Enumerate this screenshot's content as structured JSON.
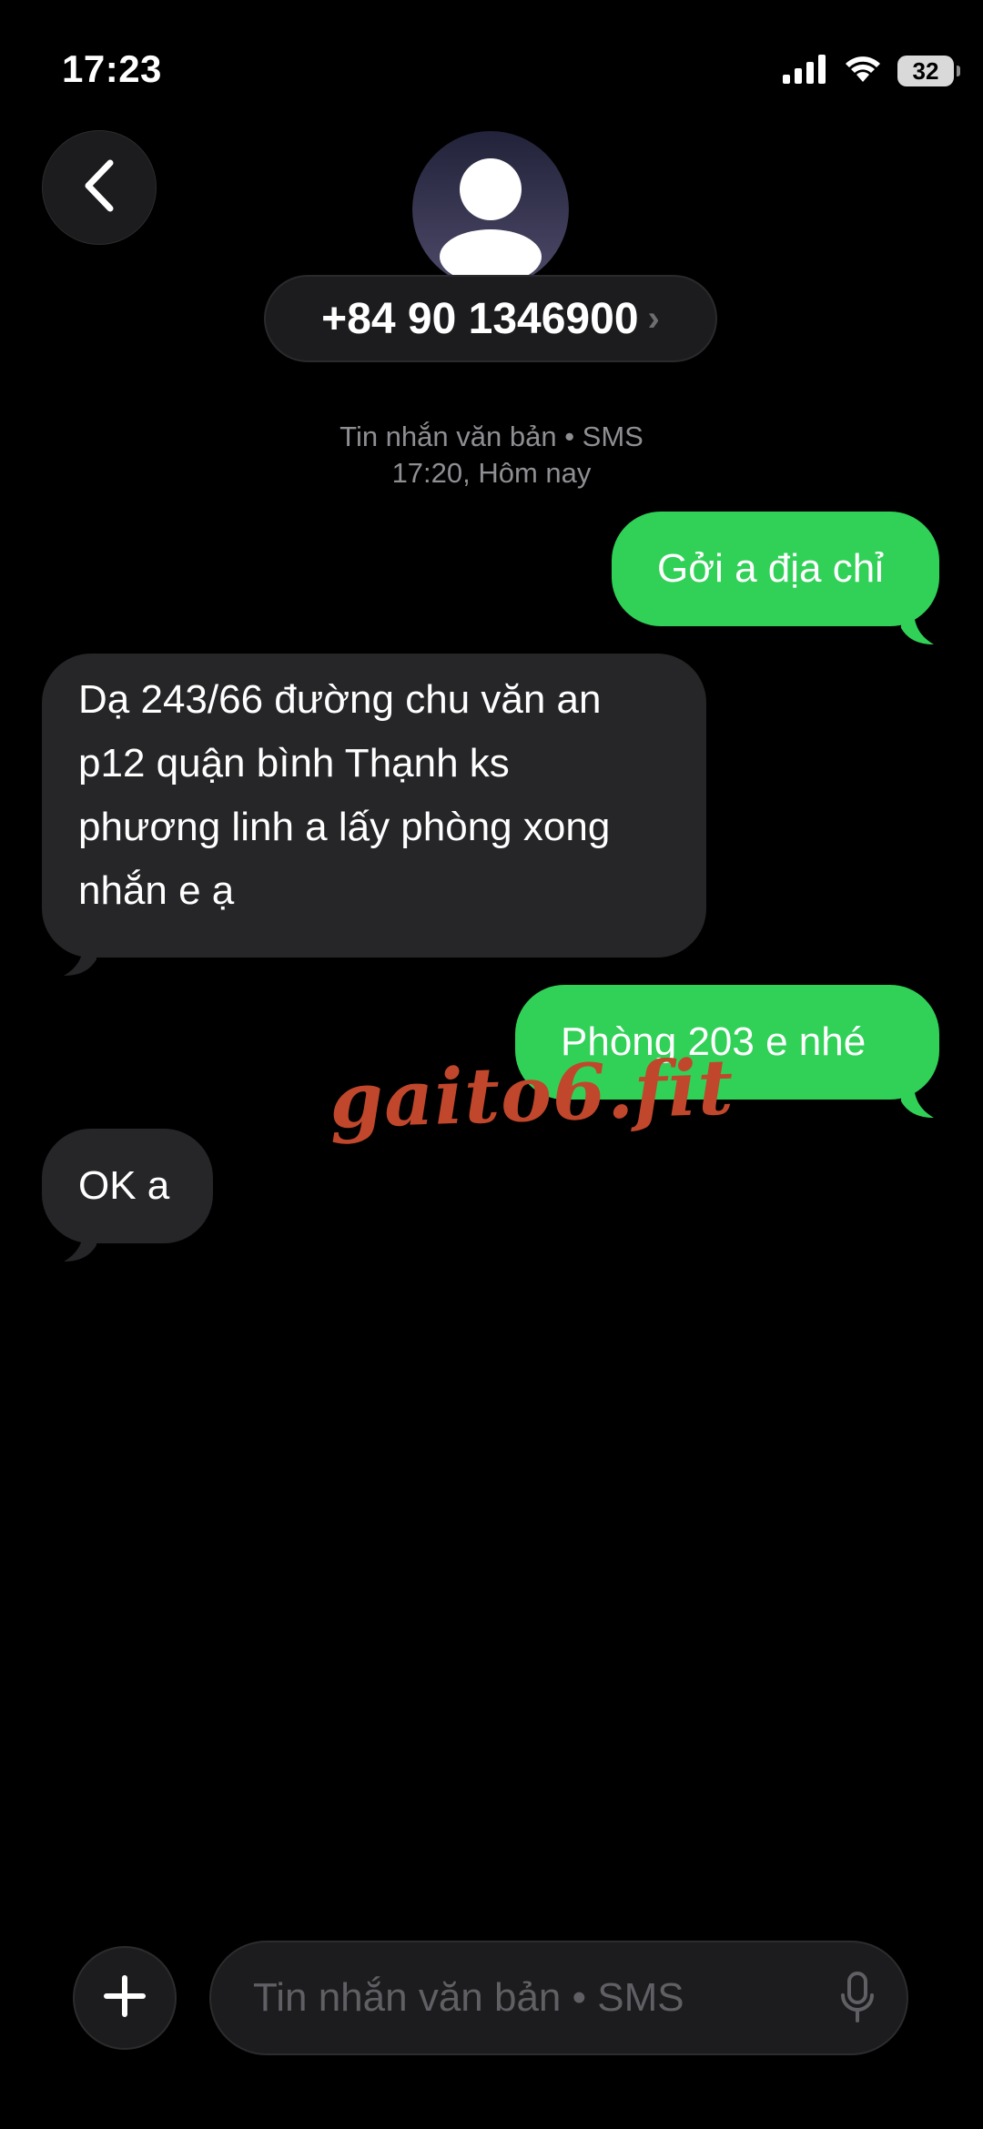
{
  "status_bar": {
    "time": "17:23",
    "battery": "32"
  },
  "header": {
    "contact_number": "+84 90 1346900",
    "chevron": "›",
    "back_icon": "chevron-left-icon",
    "avatar_icon": "person-silhouette-icon"
  },
  "conversation": {
    "channel_label": "Tin nhắn văn bản • SMS",
    "timestamp": "17:20, Hôm nay",
    "messages": [
      {
        "direction": "outgoing",
        "text": "Gởi a địa chỉ"
      },
      {
        "direction": "incoming",
        "lines": [
          "Dạ 243/66 đường chu văn an",
          "p12 quận bình Thạnh ks",
          "phương linh a lấy phòng xong",
          "nhắn e ạ"
        ]
      },
      {
        "direction": "outgoing",
        "text": "Phòng 203 e nhé"
      },
      {
        "direction": "incoming",
        "text": "OK a"
      }
    ]
  },
  "watermark": "gaito6.fit",
  "composer": {
    "placeholder": "Tin nhắn văn bản • SMS",
    "plus_icon": "plus-icon",
    "mic_icon": "microphone-icon"
  },
  "colors": {
    "background": "#000000",
    "outgoing_bubble": "#31d158",
    "incoming_bubble": "#262628",
    "meta_text": "#8e8e93",
    "watermark": "#c0472c"
  }
}
